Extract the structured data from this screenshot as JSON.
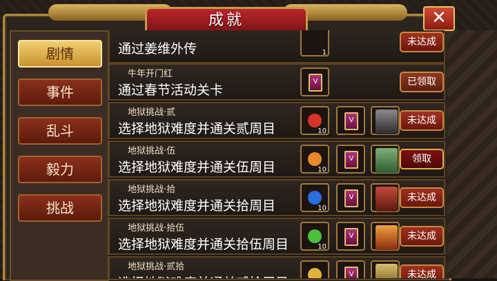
{
  "window": {
    "title": "成就",
    "close_label": "✕"
  },
  "sidebar": {
    "tabs": [
      {
        "label": "剧情",
        "active": true
      },
      {
        "label": "事件",
        "active": false
      },
      {
        "label": "乱斗",
        "active": false
      },
      {
        "label": "毅力",
        "active": false
      },
      {
        "label": "挑战",
        "active": false
      }
    ]
  },
  "achievements": [
    {
      "subtitle": "",
      "title": "通过姜维外传",
      "rewards": [
        "item"
      ],
      "qty": "1",
      "status": "未达成"
    },
    {
      "subtitle": "牛年开门红",
      "title": "通过春节活动关卡",
      "rewards": [
        "book"
      ],
      "status": "已领取"
    },
    {
      "subtitle": "地狱挑战·贰",
      "title": "选择地狱难度并通关贰周目",
      "gem_qty": "10",
      "status": "未达成"
    },
    {
      "subtitle": "地狱挑战·伍",
      "title": "选择地狱难度并通关伍周目",
      "gem_qty": "10",
      "status": "领取"
    },
    {
      "subtitle": "地狱挑战·拾",
      "title": "选择地狱难度并通关拾周目",
      "gem_qty": "10",
      "status": "未达成"
    },
    {
      "subtitle": "地狱挑战·拾伍",
      "title": "选择地狱难度并通关拾伍周目",
      "gem_qty": "10",
      "status": "未达成"
    },
    {
      "subtitle": "地狱挑战·贰拾",
      "title": "选择地狱难度并通关贰拾周目",
      "gem_qty": "",
      "status": "未达成"
    }
  ],
  "book_glyph": "V",
  "colors": {
    "gem_red": "#d8342a",
    "gem_orange": "#e98a2a",
    "gem_blue": "#2a6ee0",
    "gem_green": "#4bbf3a",
    "gem_gold": "#e0b23a"
  }
}
